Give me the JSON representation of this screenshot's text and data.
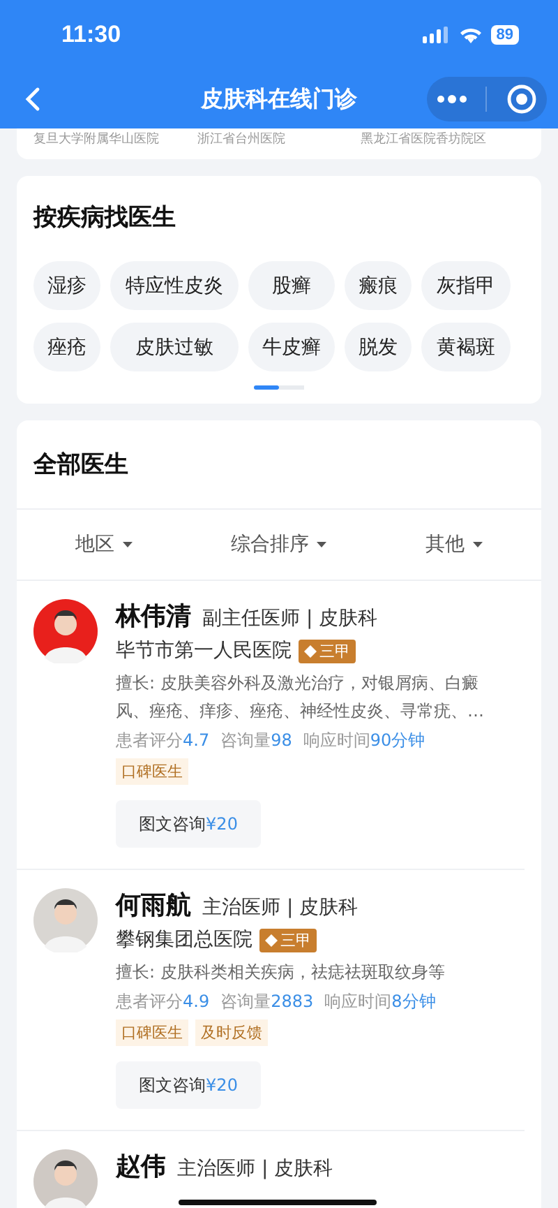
{
  "status_bar": {
    "time": "11:30",
    "battery": "89"
  },
  "nav": {
    "title": "皮肤科在线门诊"
  },
  "top_hospitals": [
    "复旦大学附属华山医院",
    "浙江省台州医院",
    "黑龙江省医院香坊院区"
  ],
  "disease_section": {
    "title": "按疾病找医生",
    "tags": [
      "湿疹",
      "特应性皮炎",
      "股癣",
      "瘢痕",
      "灰指甲",
      "痤疮",
      "皮肤过敏",
      "牛皮癣",
      "脱发",
      "黄褐斑"
    ],
    "pages": [
      {
        "selected": true
      },
      {
        "selected": false
      }
    ]
  },
  "doctors_section": {
    "title": "全部医生",
    "filters": [
      "地区",
      "综合排序",
      "其他"
    ],
    "doctors": [
      {
        "name": "林伟清",
        "title": "副主任医师 | 皮肤科",
        "hospital": "毕节市第一人民医院",
        "grade": "三甲",
        "specialty": "擅长: 皮肤美容外科及激光治疗，对银屑病、白癜风、痤疮、痒疹、痤疮、神经性皮炎、寻常疣、…",
        "stats": [
          {
            "label": "患者评分",
            "value": "4.7"
          },
          {
            "label": "咨询量",
            "value": "98"
          },
          {
            "label": "响应时间",
            "value": "90分钟"
          }
        ],
        "tags": [
          "口碑医生"
        ],
        "consult": {
          "label": "图文咨询",
          "price": "¥20"
        }
      },
      {
        "name": "何雨航",
        "title": "主治医师 | 皮肤科",
        "hospital": "攀钢集团总医院",
        "grade": "三甲",
        "specialty": "擅长: 皮肤科类相关疾病，祛痣祛斑取纹身等",
        "stats": [
          {
            "label": "患者评分",
            "value": "4.9"
          },
          {
            "label": "咨询量",
            "value": "2883"
          },
          {
            "label": "响应时间",
            "value": "8分钟"
          }
        ],
        "tags": [
          "口碑医生",
          "及时反馈"
        ],
        "consult": {
          "label": "图文咨询",
          "price": "¥20"
        }
      },
      {
        "name": "赵伟",
        "title": "主治医师 | 皮肤科"
      }
    ]
  }
}
